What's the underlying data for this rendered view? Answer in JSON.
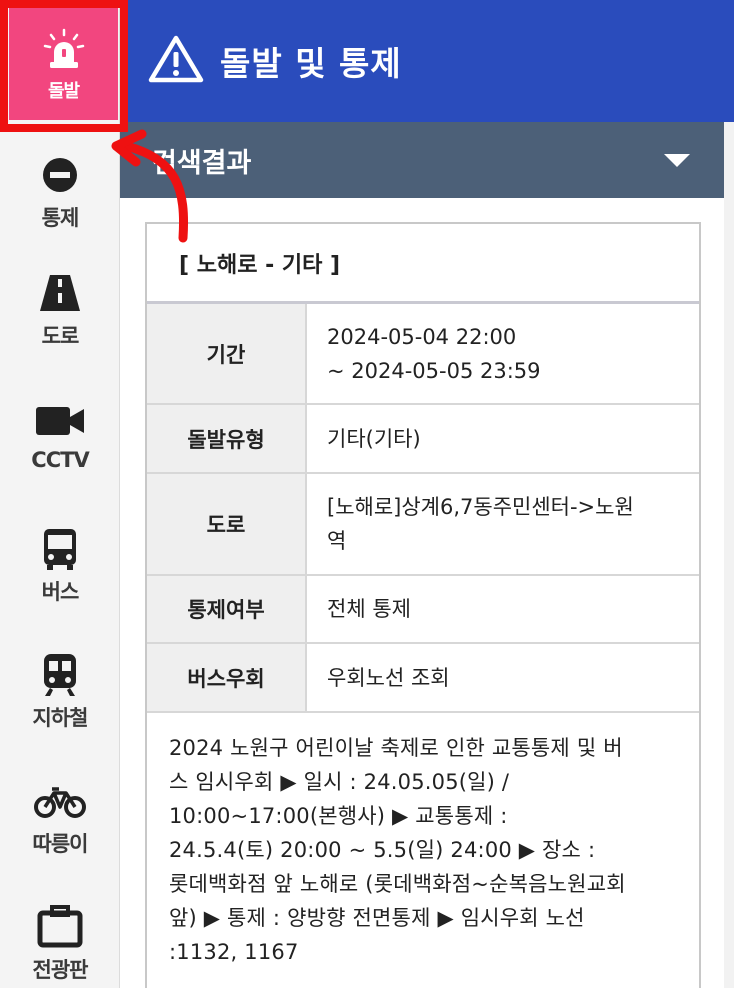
{
  "sidebar": {
    "items": [
      {
        "label": "돌발",
        "icon": "siren-icon",
        "active": true
      },
      {
        "label": "통제",
        "icon": "no-entry-icon"
      },
      {
        "label": "도로",
        "icon": "road-icon"
      },
      {
        "label": "CCTV",
        "icon": "camera-icon"
      },
      {
        "label": "버스",
        "icon": "bus-icon"
      },
      {
        "label": "지하철",
        "icon": "subway-icon"
      },
      {
        "label": "따릉이",
        "icon": "bicycle-icon"
      },
      {
        "label": "전광판",
        "icon": "signboard-icon"
      }
    ]
  },
  "header": {
    "title": "돌발 및 통제"
  },
  "result": {
    "label": "검색결과"
  },
  "card": {
    "title": "[ 노해로 - 기타 ]",
    "rows": [
      {
        "key": "기간",
        "value": [
          "2024-05-04 22:00",
          "~ 2024-05-05 23:59"
        ]
      },
      {
        "key": "돌발유형",
        "value": [
          "기타(기타)"
        ]
      },
      {
        "key": "도로",
        "value": [
          "[노해로]상계6,7동주민센터->노원",
          "역"
        ]
      },
      {
        "key": "통제여부",
        "value": [
          "전체 통제"
        ]
      },
      {
        "key": "버스우회",
        "value": [
          "우회노선 조회"
        ]
      }
    ],
    "description": [
      "2024 노원구 어린이날 축제로 인한 교통통제 및 버",
      "스 임시우회 ▶ 일시 : 24.05.05(일) /",
      "10:00~17:00(본행사) ▶ 교통통제 :",
      "24.5.4(토) 20:00 ~ 5.5(일) 24:00 ▶ 장소 :",
      "롯데백화점 앞 노해로 (롯데백화점~순복음노원교회",
      "앞) ▶ 통제 : 양방향 전면통제 ▶ 임시우회 노선",
      ":1132, 1167"
    ]
  },
  "colors": {
    "header_blue": "#2a4cbc",
    "active_pink": "#f2467f",
    "annotation_red": "#ee1111",
    "result_bar": "#4c6078"
  }
}
